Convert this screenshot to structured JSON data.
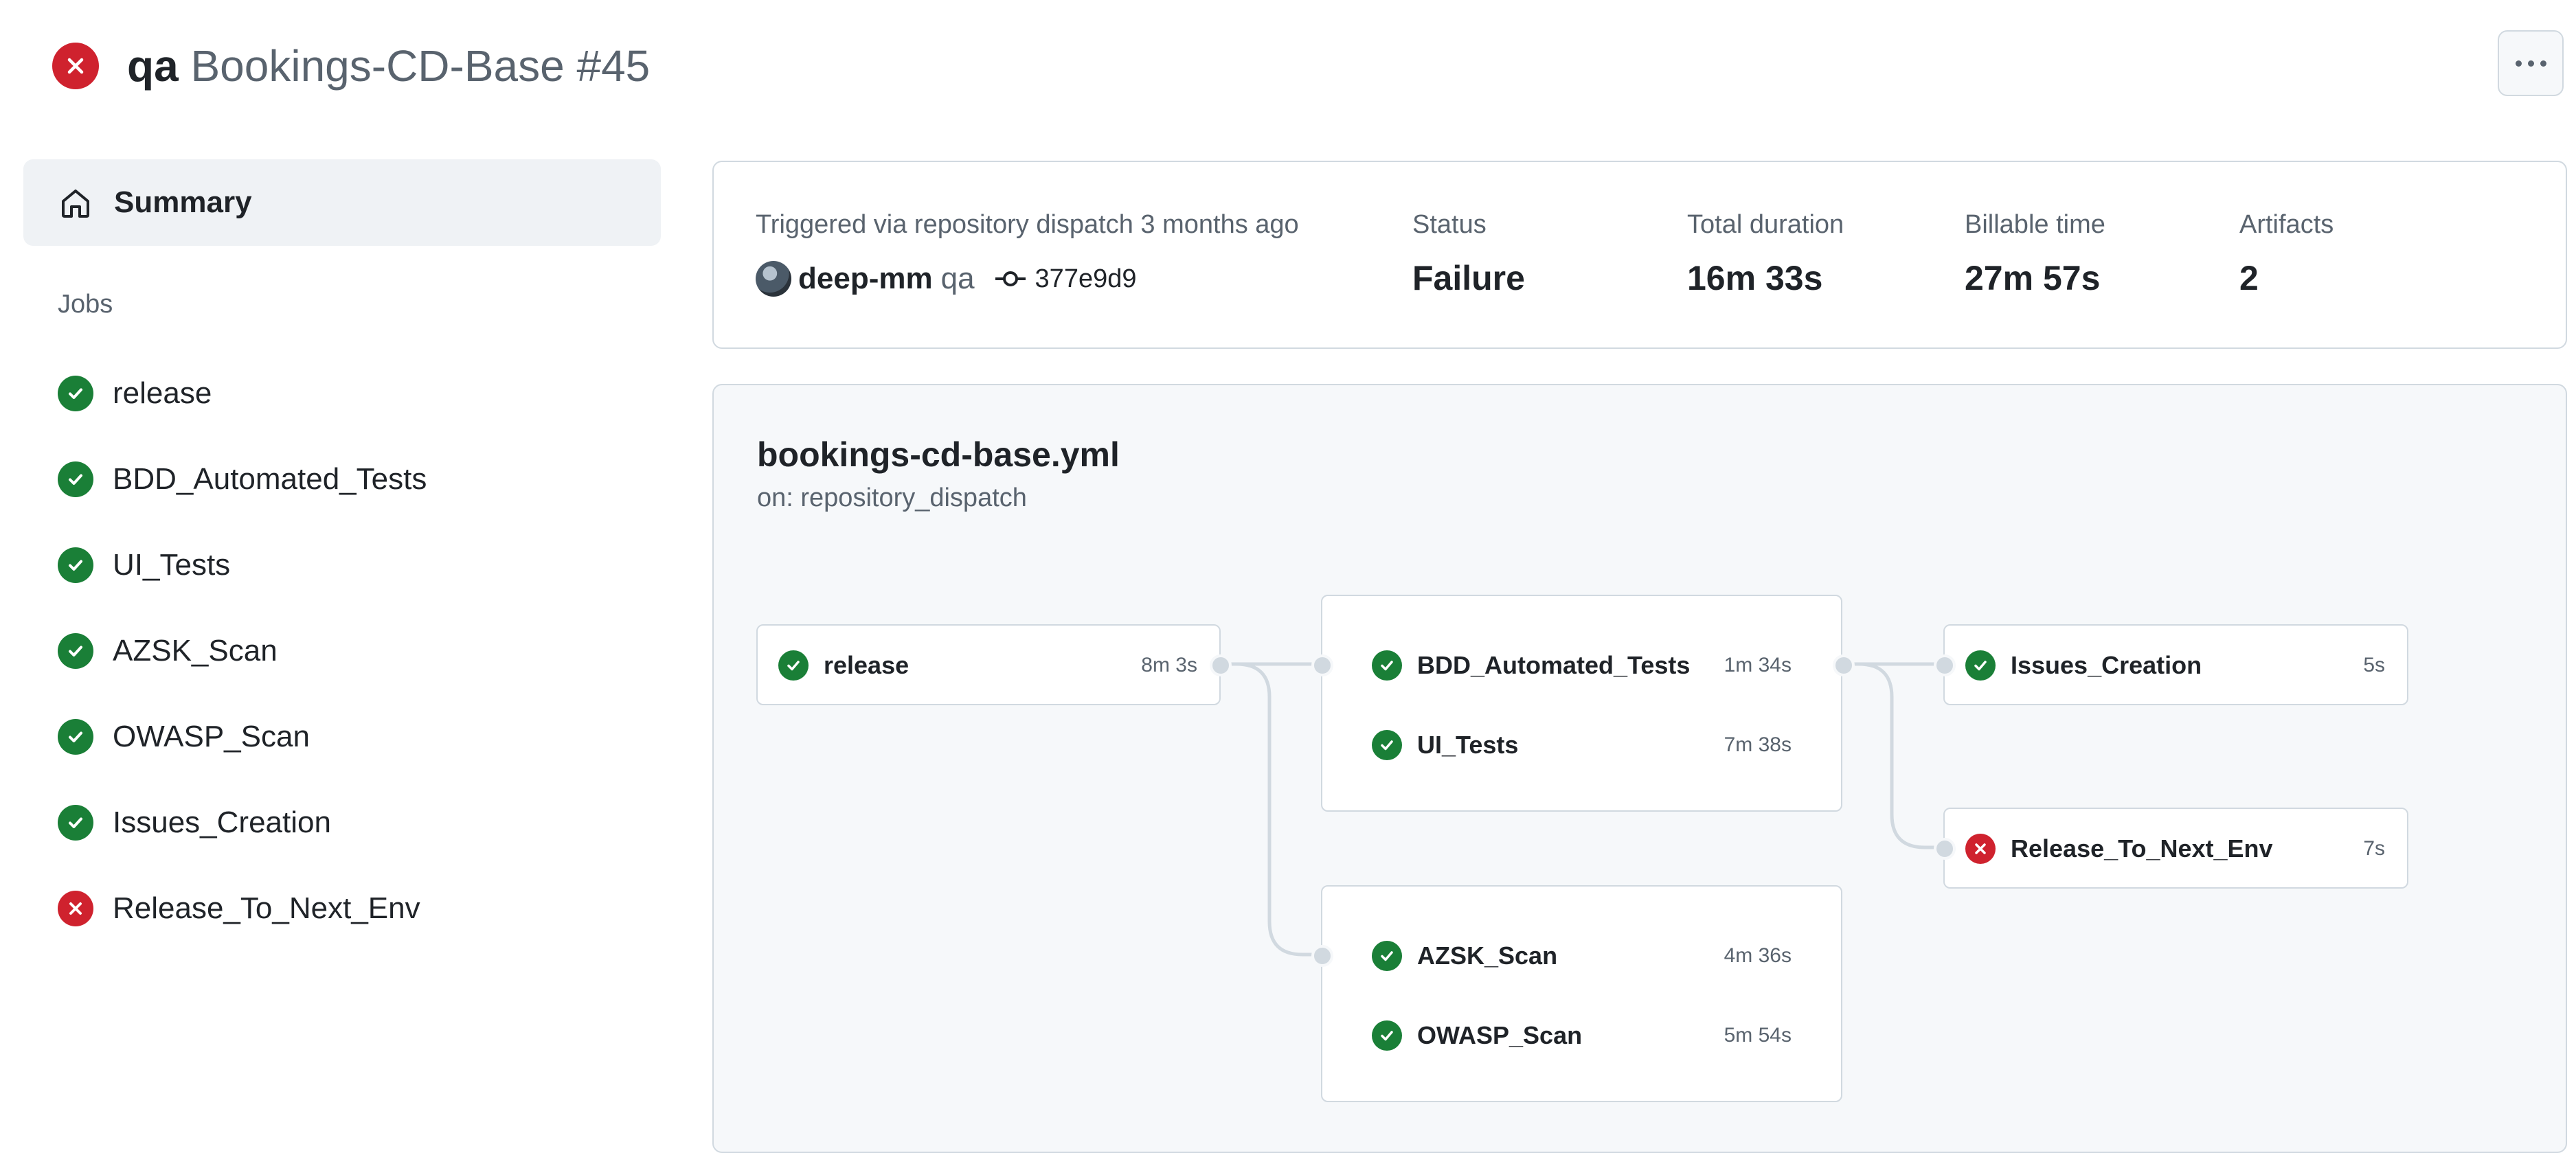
{
  "header": {
    "workflow": "qa",
    "run_name": "Bookings-CD-Base #45",
    "status_icon": "x-circle-fill-icon",
    "more_icon": "kebab-horizontal-icon"
  },
  "sidebar": {
    "summary_label": "Summary",
    "jobs_heading": "Jobs",
    "jobs": [
      {
        "label": "release",
        "status": "success"
      },
      {
        "label": "BDD_Automated_Tests",
        "status": "success"
      },
      {
        "label": "UI_Tests",
        "status": "success"
      },
      {
        "label": "AZSK_Scan",
        "status": "success"
      },
      {
        "label": "OWASP_Scan",
        "status": "success"
      },
      {
        "label": "Issues_Creation",
        "status": "success"
      },
      {
        "label": "Release_To_Next_Env",
        "status": "failure"
      }
    ]
  },
  "summary": {
    "trigger_text": "Triggered via repository dispatch 3 months ago",
    "actor": "deep-mm",
    "branch": "qa",
    "commit": "377e9d9",
    "status_label": "Status",
    "status_value": "Failure",
    "duration_label": "Total duration",
    "duration_value": "16m 33s",
    "billable_label": "Billable time",
    "billable_value": "27m 57s",
    "artifacts_label": "Artifacts",
    "artifacts_value": "2"
  },
  "graph": {
    "file": "bookings-cd-base.yml",
    "trigger": "on: repository_dispatch",
    "nodes": {
      "release": {
        "name": "release",
        "duration": "8m 3s",
        "status": "success"
      },
      "bdd": {
        "name": "BDD_Automated_Tests",
        "duration": "1m 34s",
        "status": "success"
      },
      "ui": {
        "name": "UI_Tests",
        "duration": "7m 38s",
        "status": "success"
      },
      "azsk": {
        "name": "AZSK_Scan",
        "duration": "4m 36s",
        "status": "success"
      },
      "owasp": {
        "name": "OWASP_Scan",
        "duration": "5m 54s",
        "status": "success"
      },
      "issues": {
        "name": "Issues_Creation",
        "duration": "5s",
        "status": "success"
      },
      "next_env": {
        "name": "Release_To_Next_Env",
        "duration": "7s",
        "status": "failure"
      }
    }
  },
  "colors": {
    "success": "#1a7f37",
    "failure": "#cf222e",
    "border": "#d1d9e0",
    "muted_text": "#59636e"
  }
}
